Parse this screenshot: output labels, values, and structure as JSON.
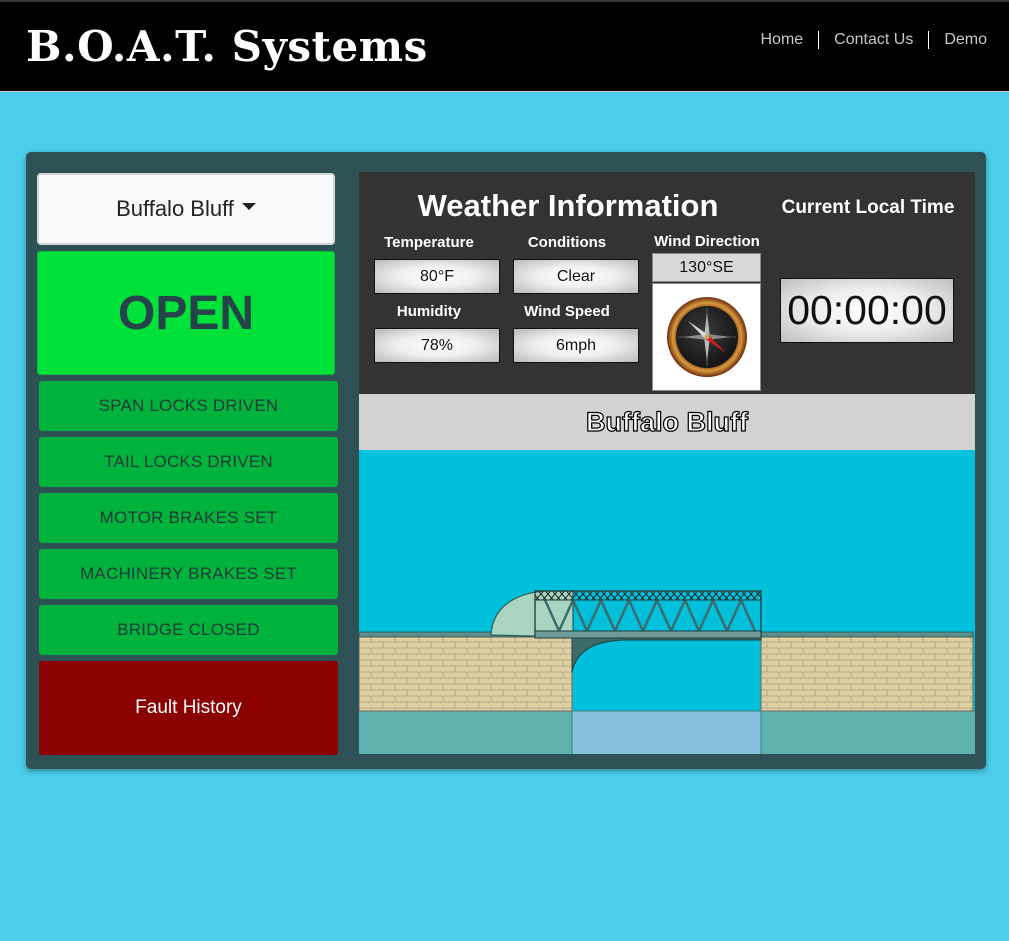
{
  "header": {
    "brand": "B.O.A.T. Systems",
    "nav": [
      "Home",
      "Contact Us",
      "Demo"
    ]
  },
  "controls": {
    "bridge_select": "Buffalo Bluff",
    "status": "OPEN",
    "indicators": [
      "SPAN LOCKS DRIVEN",
      "TAIL LOCKS DRIVEN",
      "MOTOR BRAKES SET",
      "MACHINERY BRAKES SET",
      "BRIDGE CLOSED"
    ],
    "fault_button": "Fault History"
  },
  "weather": {
    "title": "Weather Information",
    "temperature_label": "Temperature",
    "temperature": "80°F",
    "conditions_label": "Conditions",
    "conditions": "Clear",
    "humidity_label": "Humidity",
    "humidity": "78%",
    "wind_speed_label": "Wind Speed",
    "wind_speed": "6mph",
    "wind_direction_label": "Wind Direction",
    "wind_direction": "130°SE",
    "compass_icon": "compass-icon"
  },
  "clock": {
    "label": "Current Local Time",
    "time": "00:00:00"
  },
  "bridge": {
    "name": "Buffalo Bluff"
  },
  "colors": {
    "page_bg": "#4ccdea",
    "panel_bg": "#2d5155",
    "open_green": "#00e13a",
    "indicator_green": "#00b33c",
    "fault_red": "#8b0000",
    "water": "#00c0dc"
  }
}
